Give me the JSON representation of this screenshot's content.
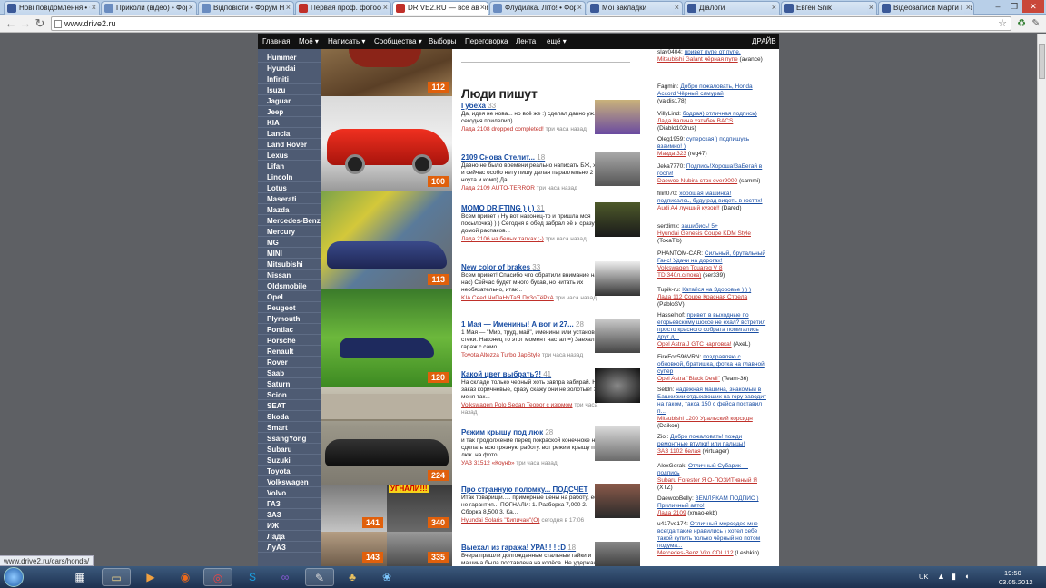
{
  "browser": {
    "tabs": [
      {
        "label": "Нові повідомлення • Ф",
        "color": "#3b5998"
      },
      {
        "label": "Приколи (відео) • Фор",
        "color": "#6a8cc0"
      },
      {
        "label": "Відповісти • Форум Н",
        "color": "#6a8cc0"
      },
      {
        "label": "Первая проф. фотосес",
        "color": "#c0302a"
      },
      {
        "label": "DRIVE2.RU — все автом",
        "color": "#c0302a"
      },
      {
        "label": "Флудилка. Літо! • Фору",
        "color": "#6a8cc0"
      },
      {
        "label": "Мої закладки",
        "color": "#3b5998"
      },
      {
        "label": "Діалоги",
        "color": "#3b5998"
      },
      {
        "label": "Евген Snik",
        "color": "#3b5998"
      },
      {
        "label": "Відеозаписи Марти Гор",
        "color": "#3b5998"
      }
    ],
    "url": "www.drive2.ru",
    "status_url": "www.drive2.ru/cars/honda/"
  },
  "site": {
    "nav": [
      "Главная",
      "Моё ▾",
      "Написать ▾",
      "Сообщества ▾",
      "Выборы",
      "Переговорка",
      "Лента",
      "ещё ▾"
    ],
    "nav_right": "ДРАЙВ",
    "brands": [
      "Hummer",
      "Hyundai",
      "Infiniti",
      "Isuzu",
      "Jaguar",
      "Jeep",
      "KIA",
      "Lancia",
      "Land Rover",
      "Lexus",
      "Lifan",
      "Lincoln",
      "Lotus",
      "Maserati",
      "Mazda",
      "Mercedes-Benz",
      "Mercury",
      "MG",
      "MINI",
      "Mitsubishi",
      "Nissan",
      "Oldsmobile",
      "Opel",
      "Peugeot",
      "Plymouth",
      "Pontiac",
      "Porsche",
      "Renault",
      "Rover",
      "Saab",
      "Saturn",
      "Scion",
      "SEAT",
      "Skoda",
      "Smart",
      "SsangYong",
      "Subaru",
      "Suzuki",
      "Toyota",
      "Volkswagen",
      "Volvo",
      "ГАЗ",
      "ЗАЗ",
      "ИЖ",
      "Лада",
      "ЛуАЗ"
    ],
    "photos": [
      {
        "count": "112"
      },
      {
        "count": "100"
      },
      {
        "count": "113"
      },
      {
        "count": "120"
      },
      {
        "count": "224"
      },
      {
        "count": "141"
      },
      {
        "count": "340",
        "caption": "УГНАЛИ!!!"
      },
      {
        "count": "143"
      },
      {
        "count": "335"
      }
    ],
    "people_title": "Люди пишут",
    "posts": [
      {
        "title": "Губёха",
        "count": "33",
        "body": "Да, идея не нова... но всё же :) сделал давно уж... а сегодня прилепил)",
        "car": "Лада 2108 dropped completed!",
        "time": "три часа назад"
      },
      {
        "title": "2109 Снова Стелит...",
        "count": "18",
        "body": "Давно не было времени реально написать БЖ, хотя и сейчас особо нету пишу делая параллельно 2 ноута и комп) Да...",
        "car": "Лада 2109 AUTO-TERROR",
        "time": "три часа назад"
      },
      {
        "title": "MOMO DRIFTING ) ) )",
        "count": "31",
        "body": "Всем привет ) Ну вот наконец-то и пришла моя посылочка) ) ) Сегодня в обед забрал её и сразу же домой распаков...",
        "car": "Лада 2106 на белых тапках ;-)",
        "time": "три часа назад"
      },
      {
        "title": "New color of brakes",
        "count": "33",
        "body": "Всем привет! Спасибо что обратили внимание на нас) Сейчас будет много букав, но читать их необязательно, итак...",
        "car": "KIA Ceed ЧиПаНуТаЯ ПуЗоТёРкА",
        "time": "три часа назад"
      },
      {
        "title": "1 Мая — Именины! А вот и 27...",
        "count": "28",
        "body": "1 Мая — \"Мир, труд, май\", именины или установка стеки. Наконец то этот момент настал =) Заехал в гараж с само...",
        "car": "Toyota Altezza Turbo JapStyle",
        "time": "три часа назад"
      },
      {
        "title": "Какой цвет выбрать?!",
        "count": "41",
        "body": "На складе только черный хоть завтра забирай. На заказ коричневые, сразу скажу они не золотые! Это меня так...",
        "car": "Volkswagen Polo Sedan Teopor с изюмом",
        "time": "три часа назад"
      },
      {
        "title": "Режим крышу под люк",
        "count": "28",
        "body": "и так продолжение перед покраской конечноке надо сделать всю грязную работу. вот режим крышу под люк. на фото...",
        "car": "УАЗ 31512 «Коунb»",
        "time": "три часа назад"
      },
      {
        "title": "Про странную поломку... ПОДСЧЕТ ЦИФР...",
        "count": "100",
        "body": "Итак товарищи..... примерные цены на работу, если не гарантия... ПОГНАЛИ: 1. Разборка 7,000 2. Сборка 8,500 3. Ка...",
        "car": "Hyundai Solaris \"Кипичан\"(О)",
        "time": "сегодня в 17:06"
      },
      {
        "title": "Выехал из гаража! УРА! ! ! :D",
        "count": "18",
        "body": "Вчера пришли долгожданные стальные гайки и машина была поставлена на колёса. Не удержался и прокатился вдоль...",
        "car": "",
        "time": ""
      }
    ],
    "comments": [
      {
        "user": "slav0404",
        "text": "привет пупе от пупе.",
        "car": "Mitsubishi Galant чёрная пупе",
        "owner": "(avance)"
      },
      {
        "user": "Fagmin",
        "text": "Добро пожаловать, Honda Accord Чёрный самурай",
        "car": "",
        "owner": "(valdis178)"
      },
      {
        "user": "VillyLind",
        "text": "бодрая) отличная подпись)",
        "car": "Лада Калина хэтчбек BACS",
        "owner": "(Diablo102rus)"
      },
      {
        "user": "Oleg1959",
        "text": "суперская ) подпишусь взаимно! )",
        "car": "Мазда 323",
        "owner": "(reg47)"
      },
      {
        "user": "Jeka7770",
        "text": "Подпись!Хороша!ЗаБегай в гости!",
        "car": "Daewoo Nubira сток over9000",
        "owner": "(sammi)"
      },
      {
        "user": "filin070",
        "text": "хорошая машинка! подписалсь, буду рад видеть в гостях!",
        "car": "Audi A4 лучший кузов!!",
        "owner": "(Dared)"
      },
      {
        "user": "serdimx",
        "text": "зашибись! 5+",
        "car": "Hyundai Genesis Coupe KDM Style",
        "owner": "(ToxaTib)"
      },
      {
        "user": "PHANTOM-CAR",
        "text": "Сильный, брутальный Ганс! Удачи на дорогах!",
        "car": "Volkswagen Touareg V 8 TDI340л.с(пока)",
        "owner": "(ser339)"
      },
      {
        "user": "Tupik-ru",
        "text": "Катайся на Здоровье ) ) )",
        "car": "Лада 112 Coupe Красная Стрела",
        "owner": "(PabloSV)"
      },
      {
        "user": "Hasselhof",
        "text": "привет. в выходные по егорьевскому шоссе не ехал? встретил просто красного собрата помигались друг д...",
        "car": "Opel Astra J GTC чартовка!",
        "owner": "(AxeL)"
      },
      {
        "user": "FireFox596VRN",
        "text": "поздравляю с обновкой, братишка, фотка на главной супер",
        "car": "Opel Astra \"Black Devil\"",
        "owner": "(Team-36)"
      },
      {
        "user": "Seldn",
        "text": "надежная машина, знакомый в Башкирии отдыхающих на гору заводит на таком, такса 150 с фейса поставил п...",
        "car": "Mitsubishi L200 Уральский корсидн",
        "owner": "(Daikon)"
      },
      {
        "user": "Zioi",
        "text": "Добро пожаловать! пожди ремонтные втулки! или пальцы!",
        "car": "ЗАЗ 1102 белая",
        "owner": "(virtuager)"
      },
      {
        "user": "AlexGerak",
        "text": "Отличный Субарик — подпись",
        "car": "Subaru Forester Я О-ПОЗИТивный Я",
        "owner": "(XTZ)"
      },
      {
        "user": "DaewooBelly",
        "text": "ЗЕМЛЯКАМ ПОДПИС ) Приличный авто!",
        "car": "Лада 2109",
        "owner": "(xmao-ekb)"
      },
      {
        "user": "u417ve174",
        "text": "Отличный мерседес мне всегда такие нравились ) хотел себе такой купить только чёрный но потом подума...",
        "car": "Mercedes-Benz Vito CDI 112",
        "owner": "(Leshkin)"
      }
    ]
  },
  "taskbar": {
    "lang": "UK",
    "time": "19:50",
    "date": "03.05.2012"
  }
}
